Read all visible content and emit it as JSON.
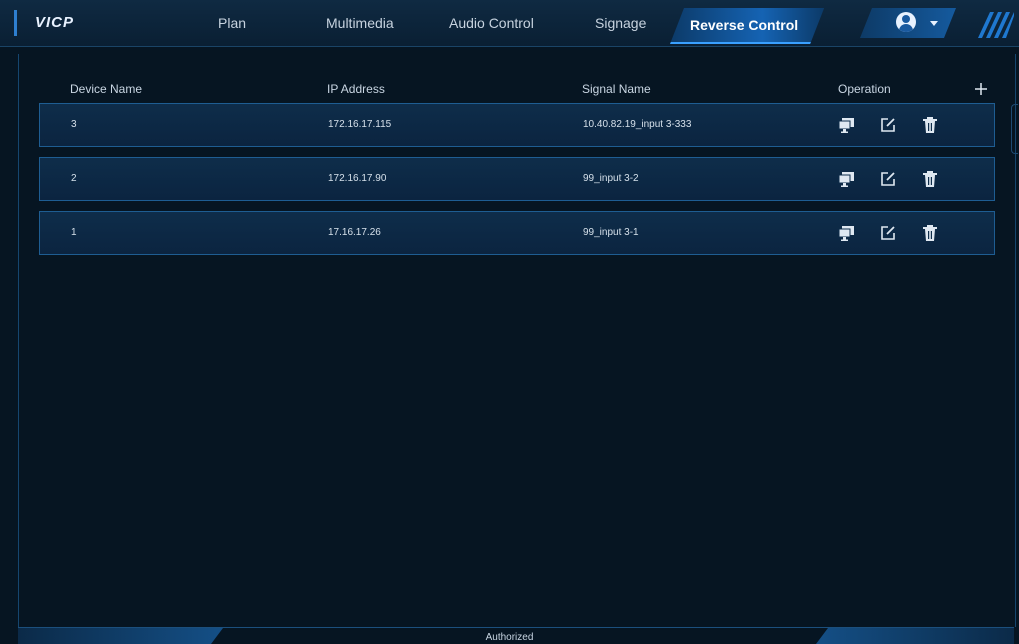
{
  "app": {
    "brand": "VICP"
  },
  "nav": {
    "items": [
      {
        "label": "Plan"
      },
      {
        "label": "Multimedia"
      },
      {
        "label": "Audio Control"
      },
      {
        "label": "Signage"
      },
      {
        "label": "Reverse Control"
      }
    ],
    "active": "Reverse Control"
  },
  "table": {
    "columns": {
      "device_name": "Device Name",
      "ip_address": "IP Address",
      "signal_name": "Signal Name",
      "operation": "Operation"
    },
    "rows": [
      {
        "device_name": "3",
        "ip_address": "172.16.17.115",
        "signal_name": "10.40.82.19_input 3-333"
      },
      {
        "device_name": "2",
        "ip_address": "172.16.17.90",
        "signal_name": "99_input 3-2"
      },
      {
        "device_name": "1",
        "ip_address": "17.16.17.26",
        "signal_name": "99_input 3-1"
      }
    ]
  },
  "status": {
    "text": "Authorized"
  },
  "icons": {
    "add": "plus-icon",
    "control": "remote-screen-icon",
    "edit": "edit-icon",
    "delete": "trash-icon"
  },
  "colors": {
    "accent": "#1563b3",
    "background": "#061522",
    "row_border": "#1e5d92"
  }
}
